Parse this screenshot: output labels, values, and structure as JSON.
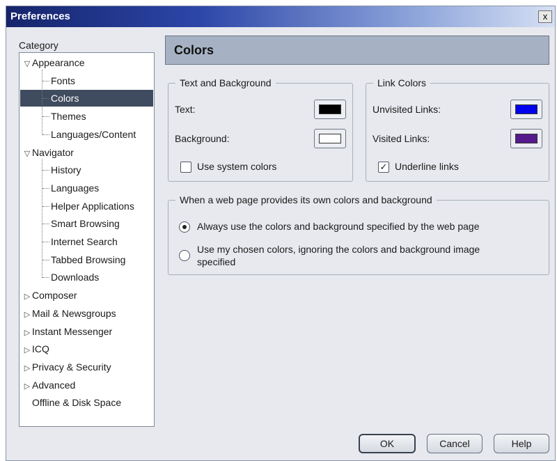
{
  "window": {
    "title": "Preferences",
    "close_glyph": "x"
  },
  "category_label": "Category",
  "tree": [
    {
      "label": "Appearance",
      "expander": "▽",
      "child": false
    },
    {
      "label": "Fonts",
      "expander": "",
      "child": true
    },
    {
      "label": "Colors",
      "expander": "",
      "child": true,
      "selected": true
    },
    {
      "label": "Themes",
      "expander": "",
      "child": true
    },
    {
      "label": "Languages/Content",
      "expander": "",
      "child": true
    },
    {
      "label": "Navigator",
      "expander": "▽",
      "child": false
    },
    {
      "label": "History",
      "expander": "",
      "child": true
    },
    {
      "label": "Languages",
      "expander": "",
      "child": true
    },
    {
      "label": "Helper Applications",
      "expander": "",
      "child": true
    },
    {
      "label": "Smart Browsing",
      "expander": "",
      "child": true
    },
    {
      "label": "Internet Search",
      "expander": "",
      "child": true
    },
    {
      "label": "Tabbed Browsing",
      "expander": "",
      "child": true
    },
    {
      "label": "Downloads",
      "expander": "",
      "child": true
    },
    {
      "label": "Composer",
      "expander": "▷",
      "child": false
    },
    {
      "label": "Mail & Newsgroups",
      "expander": "▷",
      "child": false
    },
    {
      "label": "Instant Messenger",
      "expander": "▷",
      "child": false
    },
    {
      "label": "ICQ",
      "expander": "▷",
      "child": false
    },
    {
      "label": "Privacy & Security",
      "expander": "▷",
      "child": false
    },
    {
      "label": "Advanced",
      "expander": "▷",
      "child": false
    },
    {
      "label": "Offline & Disk Space",
      "expander": "",
      "child": false
    }
  ],
  "panel": {
    "title": "Colors",
    "text_bg": {
      "title": "Text and Background",
      "text_label": "Text:",
      "background_label": "Background:",
      "use_system_label": "Use system colors",
      "use_system_checked": false,
      "text_color": "#000000",
      "background_color": "#ffffff"
    },
    "link_colors": {
      "title": "Link Colors",
      "unvisited_label": "Unvisited Links:",
      "visited_label": "Visited Links:",
      "underline_label": "Underline links",
      "underline_checked": true,
      "unvisited_color": "#0000ee",
      "visited_color": "#551a8b"
    },
    "override": {
      "title": "When a web page provides its own colors and background",
      "option_always": "Always use the colors and background specified by the web page",
      "option_mine_line1": "Use my chosen colors, ignoring the colors and background image",
      "option_mine_line2": "specified",
      "selected": "always"
    }
  },
  "buttons": {
    "ok": "OK",
    "cancel": "Cancel",
    "help": "Help"
  }
}
